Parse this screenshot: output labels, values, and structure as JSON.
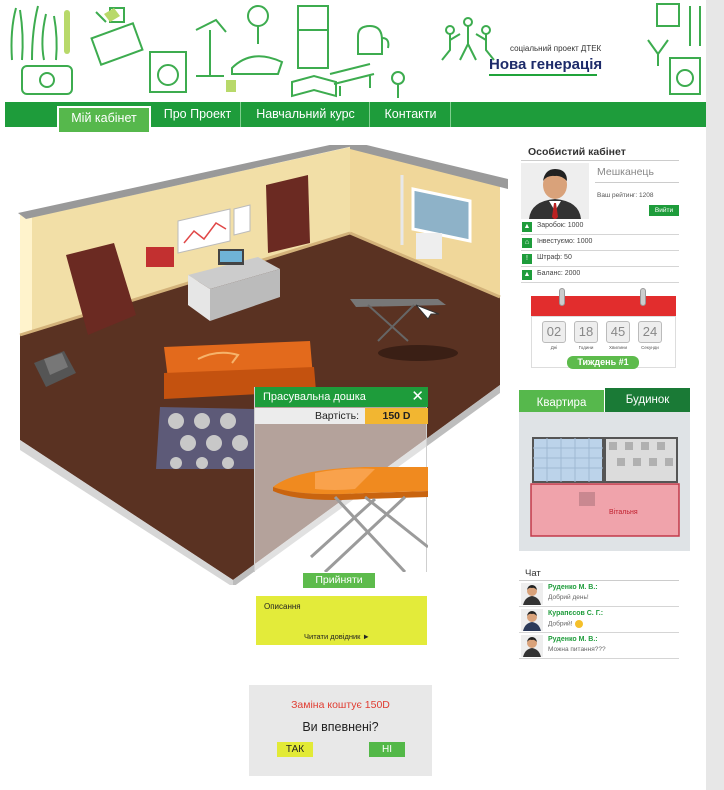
{
  "header": {
    "logo_subtitle": "соціальний проект ДТЕК",
    "logo_title": "Нова генерація"
  },
  "nav": {
    "items": [
      {
        "label": "Мій кабінет",
        "active": true
      },
      {
        "label": "Про Проект"
      },
      {
        "label": "Навчальний курс"
      },
      {
        "label": "Контакти"
      }
    ]
  },
  "item_modal": {
    "title": "Прасувальна дошка",
    "cost_label": "Вартість:",
    "cost_value": "150 D",
    "accept_label": "Прийняти",
    "description_title": "Описання",
    "description_link": "Читати довідник ►"
  },
  "confirm": {
    "cost_text": "Заміна коштує 150D",
    "question": "Ви впевнені?",
    "yes_label": "ТАК",
    "no_label": "НІ"
  },
  "cabinet": {
    "title": "Особистий кабінет",
    "rank": "Мешканець",
    "rating": "Ваш рейтинг: 1208",
    "login_label": "Вийти",
    "stats": [
      {
        "icon": "wallet-icon",
        "text": "Заробок: 1000"
      },
      {
        "icon": "invest-icon",
        "text": "Інвестуємо: 1000"
      },
      {
        "icon": "warning-icon",
        "text": "Штраф: 50"
      },
      {
        "icon": "balance-icon",
        "text": "Баланс: 2000"
      }
    ]
  },
  "calendar": {
    "digits": [
      {
        "value": "02",
        "label": "Дні"
      },
      {
        "value": "18",
        "label": "Години"
      },
      {
        "value": "45",
        "label": "Хвилини"
      },
      {
        "value": "24",
        "label": "Секунди"
      }
    ],
    "week_label": "Тиждень #1"
  },
  "plan": {
    "tabs": [
      "Квартира",
      "Будинок"
    ],
    "active_tab": "Квартира",
    "room_label": "Вітальня"
  },
  "chat": {
    "title": "Чат",
    "messages": [
      {
        "name": "Руденко М. В.:",
        "text": "Добрий день!"
      },
      {
        "name": "Курапєсов С. Г.:",
        "text": "Добрий!"
      },
      {
        "name": "Руденко М. В.:",
        "text": "Можна питання???"
      }
    ]
  },
  "colors": {
    "brand_green": "#1e9c3b",
    "light_green": "#56b84c",
    "accent_yellow": "#e3eb3a",
    "cost_orange": "#f2b631",
    "alert_red": "#e22d2d"
  }
}
